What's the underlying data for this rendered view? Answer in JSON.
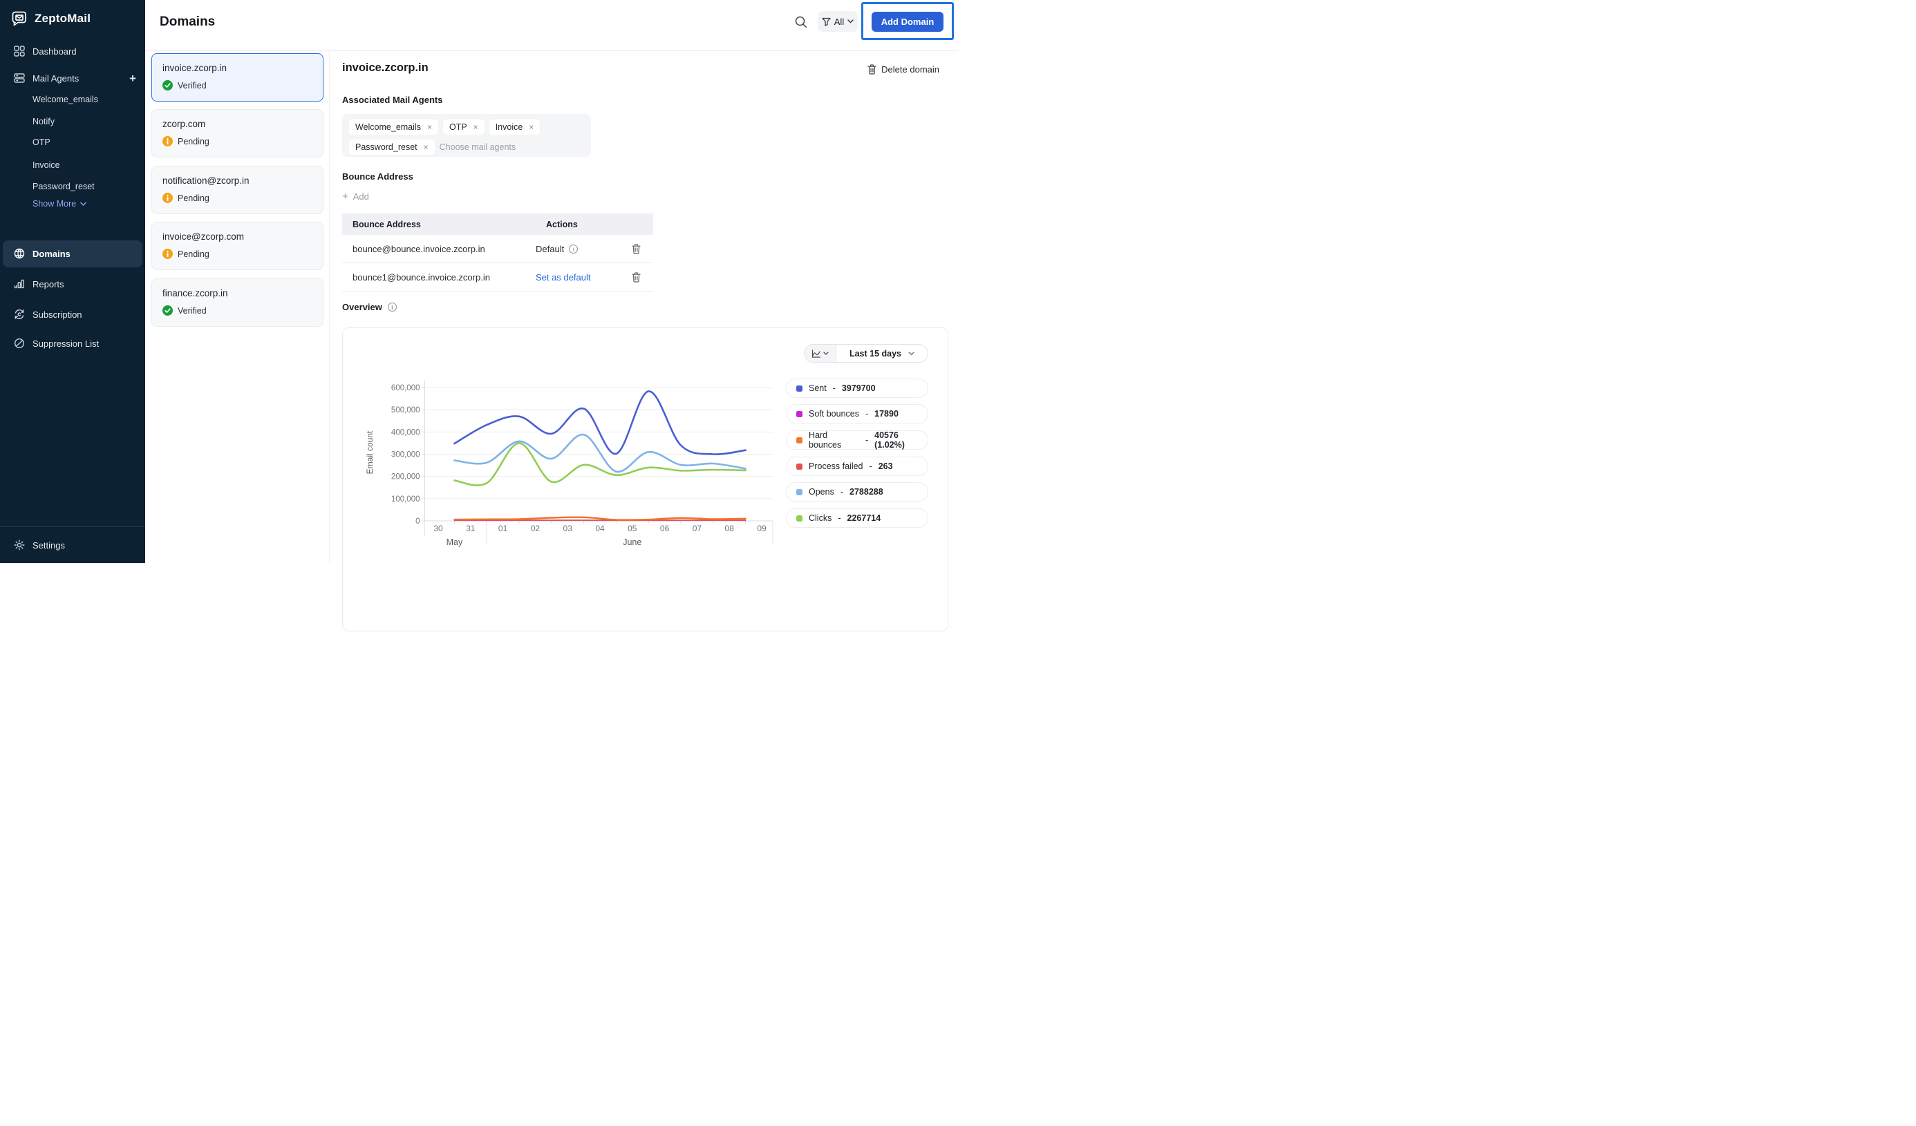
{
  "app": {
    "name": "ZeptoMail"
  },
  "ui": {
    "plus_glyph": "+",
    "close_glyph": "×"
  },
  "sidebar": {
    "dashboard": "Dashboard",
    "mail_agents": "Mail Agents",
    "agents": [
      "Welcome_emails",
      "Notify",
      "OTP",
      "Invoice",
      "Password_reset"
    ],
    "show_more": "Show More",
    "domains": "Domains",
    "reports": "Reports",
    "subscription": "Subscription",
    "suppression": "Suppression List",
    "settings": "Settings"
  },
  "header": {
    "title": "Domains",
    "filter_label": "All",
    "add_button": "Add Domain"
  },
  "domain_list": [
    {
      "name": "invoice.zcorp.in",
      "status": "Verified"
    },
    {
      "name": "zcorp.com",
      "status": "Pending"
    },
    {
      "name": "notification@zcorp.in",
      "status": "Pending"
    },
    {
      "name": "invoice@zcorp.com",
      "status": "Pending"
    },
    {
      "name": "finance.zcorp.in",
      "status": "Verified"
    }
  ],
  "detail": {
    "title": "invoice.zcorp.in",
    "delete_label": "Delete domain",
    "mail_agents_label": "Associated Mail Agents",
    "chips": [
      "Welcome_emails",
      "OTP",
      "Invoice",
      "Password_reset"
    ],
    "chips_placeholder": "Choose mail agents",
    "bounce": {
      "heading": "Bounce Address",
      "add_label": "Add",
      "columns": [
        "Bounce Address",
        "Actions"
      ],
      "rows": [
        {
          "email": "bounce@bounce.invoice.zcorp.in",
          "action": "Default"
        },
        {
          "email": "bounce1@bounce.invoice.zcorp.in",
          "action": "Set as default"
        }
      ]
    },
    "overview_label": "Overview"
  },
  "chart": {
    "range_label": "Last 15 days",
    "chart_data": {
      "type": "line",
      "title": "",
      "ylabel": "Email count",
      "ylim": [
        0,
        600000
      ],
      "grid": true,
      "legend_position": "right",
      "y_ticks": [
        0,
        100000,
        200000,
        300000,
        400000,
        500000,
        600000
      ],
      "x_ticks": [
        "30",
        "31",
        "01",
        "02",
        "03",
        "04",
        "05",
        "06",
        "07",
        "08",
        "09"
      ],
      "month_groups": [
        {
          "label": "May",
          "tick_start": 0,
          "tick_end": 1
        },
        {
          "label": "June",
          "tick_start": 2,
          "tick_end": 10
        }
      ],
      "point_days": [
        "31",
        "01",
        "02",
        "03",
        "04",
        "05",
        "06",
        "07",
        "08",
        "09"
      ],
      "series": [
        {
          "name": "Sent",
          "color": "#4a5ed2",
          "width": 2.6,
          "values": [
            348000,
            432000,
            470000,
            392000,
            505000,
            302000,
            583000,
            340000,
            300000,
            318000
          ]
        },
        {
          "name": "Opens",
          "color": "#7eb2e8",
          "width": 2.6,
          "values": [
            272000,
            262000,
            358000,
            280000,
            388000,
            222000,
            310000,
            252000,
            258000,
            235000
          ]
        },
        {
          "name": "Clicks",
          "color": "#8fce52",
          "width": 2.6,
          "values": [
            182000,
            170000,
            350000,
            176000,
            252000,
            206000,
            240000,
            226000,
            230000,
            227000
          ]
        },
        {
          "name": "Hard bounces",
          "color": "#f2712d",
          "width": 2.4,
          "values": [
            6000,
            7000,
            8000,
            14000,
            16000,
            5000,
            6000,
            13000,
            8000,
            10000
          ]
        },
        {
          "name": "Process failed",
          "color": "#e4574d",
          "width": 1.8,
          "values": [
            3000,
            3000,
            3000,
            3000,
            3000,
            3000,
            3000,
            3000,
            3000,
            3000
          ]
        },
        {
          "name": "Soft bounces",
          "color": "#ca2dd8",
          "width": 1.5,
          "values": [
            2000,
            2000,
            2000,
            2000,
            2000,
            2000,
            2000,
            2000,
            2000,
            2000
          ]
        }
      ],
      "draw_order": [
        5,
        4,
        3,
        2,
        1,
        0
      ]
    }
  },
  "legend": {
    "sep": "-",
    "items": [
      {
        "label": "Sent",
        "value": "3979700",
        "color": "#4f5bd5"
      },
      {
        "label": "Soft bounces",
        "value": "17890",
        "color": "#c924d4"
      },
      {
        "label": "Hard bounces",
        "value": "40576 (1.02%)",
        "color": "#f4772e"
      },
      {
        "label": "Process failed",
        "value": "263",
        "color": "#e4544c"
      },
      {
        "label": "Opens",
        "value": "2788288",
        "color": "#83b4ea"
      },
      {
        "label": "Clicks",
        "value": "2267714",
        "color": "#8ed14f"
      }
    ]
  }
}
